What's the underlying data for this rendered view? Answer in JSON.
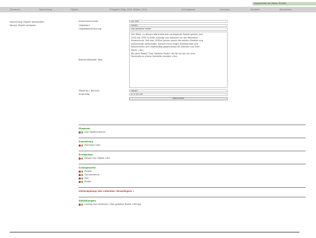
{
  "user_bar": "Angemeldet als Stefan Richter",
  "top_menu": [
    "Museum",
    "Sammlung",
    "Objekt",
    "Eingabe (Tag, Zeit, Bilder, Ort)",
    "Schlagwort",
    "Literatur",
    "Kontakt",
    "Abmelden"
  ],
  "left_nav": [
    "Sammlung-Objekt bearbeiten",
    "Neues Objekt erfassen"
  ],
  "form": {
    "inventarnummer": {
      "label": "Inventarnummer",
      "value": "NU 098"
    },
    "objektart": {
      "label": "Objektart",
      "value": "Pastell"
    },
    "objektbezeichnung": {
      "label": "Objektbezeichnung",
      "value": "Das goldene Ruder"
    },
    "beschreibung": {
      "label": "Beschreibender Text",
      "lines": [
        "Das Blatt, zu dessen Werkreihe das vorliegende Pastell gehört, war",
        "1935 bis 1939 Schüler Ludwigs von Hofmann an der Weimarer",
        "Kunstschule. Seit den 1930er Jahren waren die beiden Künstler eng",
        "miteinander befreundet, führten einen regen Briefwechsel und",
        "beschenkten sich regelmäßig gegenseitig mit Arbeiten aus ihrer",
        "Hand. <br>",
        "Bei dem Pastell \"Das Goldene Ruder\" dürfte es sich um eine",
        "Vorstudie zu einem Gemälde handeln.<br>"
      ]
    },
    "material": {
      "label": "Material / Technik",
      "value": "Pastell"
    },
    "ausmasse": {
      "label": "Ausmaße",
      "value": "41 x 65 cm"
    },
    "save_label": "Abschicken"
  },
  "sections": [
    {
      "title": "Museum",
      "items": [
        "Das Stadtmuseum"
      ]
    },
    {
      "title": "Sammlung",
      "items": [
        "Nachlass Otto"
      ]
    },
    {
      "title": "Ereignisse",
      "items": [
        "Neues von Objekt 184"
      ]
    },
    {
      "title": "Schlagworte",
      "items": [
        "Pastell",
        "Symbolismus",
        "See",
        "Ruder"
      ]
    }
  ],
  "links_heading": "Verknüpfung mit Literatur hinzufügen !",
  "images": {
    "title": "Abbildungen",
    "items": [
      "Ludwig von Hofmann, Das goldene Ruder 180.jpg"
    ]
  }
}
